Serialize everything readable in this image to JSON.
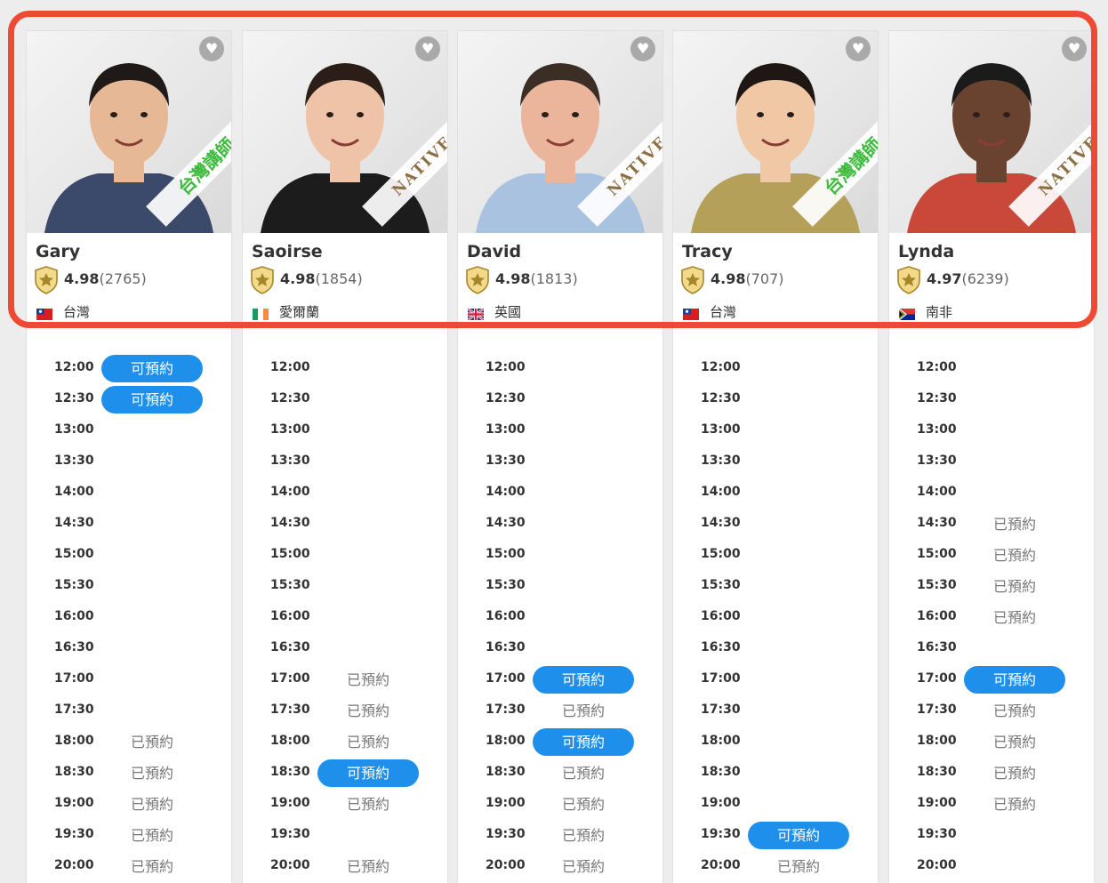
{
  "times": [
    "12:00",
    "12:30",
    "13:00",
    "13:30",
    "14:00",
    "14:30",
    "15:00",
    "15:30",
    "16:00",
    "16:30",
    "17:00",
    "17:30",
    "18:00",
    "18:30",
    "19:00",
    "19:30",
    "20:00"
  ],
  "status_labels": {
    "available": "可預約",
    "booked": "已預約"
  },
  "tutors": [
    {
      "name": "Gary",
      "rating": "4.98",
      "reviews": "(2765)",
      "country": "台灣",
      "flag": "taiwan-flag-icon",
      "ribbon": "台灣講師",
      "ribbon_type": "tw",
      "skin": "#e6b896",
      "hair": "#1f1a17",
      "shirt": "#3b4a6b",
      "slots": [
        "available",
        "available",
        "",
        "",
        "",
        "",
        "",
        "",
        "",
        "",
        "",
        "",
        "booked",
        "booked",
        "booked",
        "booked",
        "booked"
      ]
    },
    {
      "name": "Saoirse",
      "rating": "4.98",
      "reviews": "(1854)",
      "country": "愛爾蘭",
      "flag": "ireland-flag-icon",
      "ribbon": "NATIVE",
      "ribbon_type": "native",
      "skin": "#eec3a7",
      "hair": "#2b1d17",
      "shirt": "#1c1c1c",
      "slots": [
        "",
        "",
        "",
        "",
        "",
        "",
        "",
        "",
        "",
        "",
        "booked",
        "booked",
        "booked",
        "available",
        "booked",
        "",
        "booked"
      ]
    },
    {
      "name": "David",
      "rating": "4.98",
      "reviews": "(1813)",
      "country": "英國",
      "flag": "uk-flag-icon",
      "ribbon": "NATIVE",
      "ribbon_type": "native",
      "skin": "#eab59a",
      "hair": "#3b2e25",
      "shirt": "#a9c2df",
      "slots": [
        "",
        "",
        "",
        "",
        "",
        "",
        "",
        "",
        "",
        "",
        "available",
        "booked",
        "available",
        "booked",
        "booked",
        "booked",
        "booked"
      ]
    },
    {
      "name": "Tracy",
      "rating": "4.98",
      "reviews": "(707)",
      "country": "台灣",
      "flag": "taiwan-flag-icon",
      "ribbon": "台灣講師",
      "ribbon_type": "tw",
      "skin": "#f0c8a6",
      "hair": "#1e1714",
      "shirt": "#b5a05a",
      "slots": [
        "",
        "",
        "",
        "",
        "",
        "",
        "",
        "",
        "",
        "",
        "",
        "",
        "",
        "",
        "",
        "available",
        "booked"
      ]
    },
    {
      "name": "Lynda",
      "rating": "4.97",
      "reviews": "(6239)",
      "country": "南非",
      "flag": "south-africa-flag-icon",
      "ribbon": "NATIVE",
      "ribbon_type": "native",
      "skin": "#6a4330",
      "hair": "#1b1b1b",
      "shirt": "#c9483a",
      "slots": [
        "",
        "",
        "",
        "",
        "",
        "booked",
        "booked",
        "booked",
        "booked",
        "",
        "available",
        "booked",
        "booked",
        "booked",
        "booked",
        "",
        ""
      ]
    }
  ]
}
